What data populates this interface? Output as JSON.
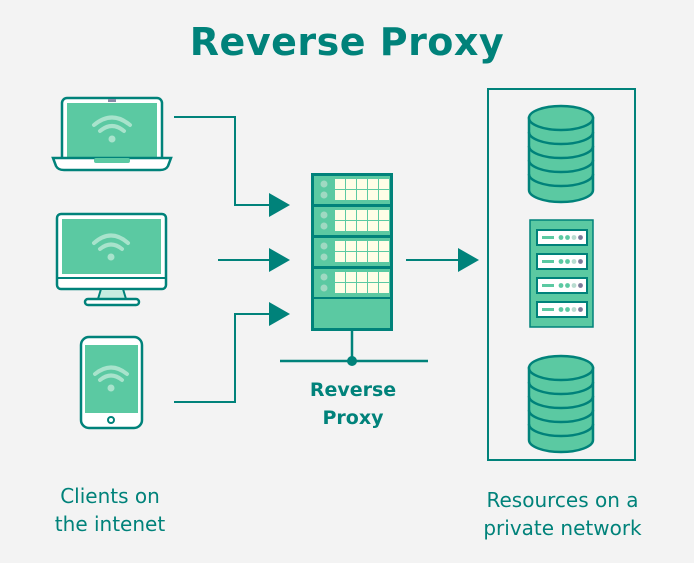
{
  "title": "Reverse Proxy",
  "clients": {
    "label_line1": "Clients on",
    "label_line2": "the intenet",
    "devices": [
      "laptop",
      "desktop-monitor",
      "tablet"
    ]
  },
  "proxy": {
    "label_line1": "Reverse",
    "label_line2": "Proxy"
  },
  "resources": {
    "label_line1": "Resources on a",
    "label_line2": "private network",
    "items": [
      "database",
      "server-rack",
      "database"
    ]
  },
  "colors": {
    "teal": "#00827a",
    "green_fill": "#5bc9a2",
    "panel_cream": "#fefde6",
    "background": "#f3f3f3"
  }
}
